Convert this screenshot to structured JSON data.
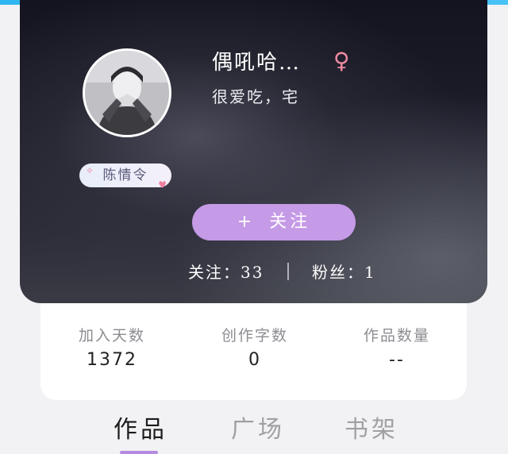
{
  "profile": {
    "nickname": "偶吼哈…",
    "gender_symbol": "♀",
    "bio": "很爱吃，宅",
    "tag": "陈情令",
    "follow_button": {
      "icon": "+",
      "label": "关注"
    },
    "following": "关注：33",
    "fans": "粉丝：1"
  },
  "stats": [
    {
      "label": "加入天数",
      "value": "1372"
    },
    {
      "label": "创作字数",
      "value": "0"
    },
    {
      "label": "作品数量",
      "value": "--"
    }
  ],
  "tabs": [
    {
      "label": "作品",
      "active": true
    },
    {
      "label": "广场",
      "active": false
    },
    {
      "label": "书架",
      "active": false
    }
  ],
  "colors": {
    "accent": "#c59ae6",
    "indicator": "#b48be0",
    "gender": "#f08aa0",
    "topbar": "#2fb6f0"
  }
}
